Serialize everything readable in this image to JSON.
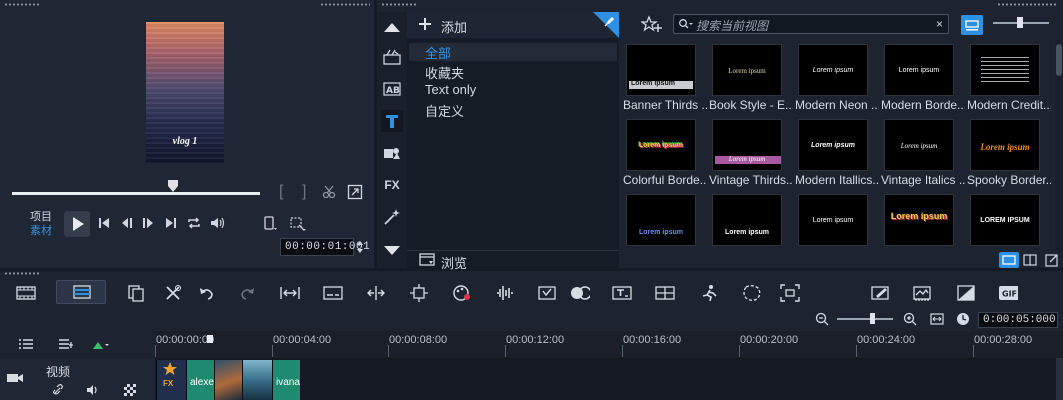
{
  "player": {
    "preview_caption": "vlog 1",
    "mode_project": "项目",
    "mode_clip": "素材",
    "timecode": "00:00:01:001",
    "progress_fraction": 0.65
  },
  "library": {
    "add_label": "添加",
    "tree": [
      "全部",
      "收藏夹",
      "Text only",
      "自定义"
    ],
    "browse_label": "浏览",
    "search_placeholder": "搜索当前视图",
    "thumbnails": [
      {
        "caption": "Banner Thirds ...",
        "sample": "Lorem ipsum"
      },
      {
        "caption": "Book Style - E...",
        "sample": "Lorem ipsum"
      },
      {
        "caption": "Modern Neon ...",
        "sample": "Lorem ipsum"
      },
      {
        "caption": "Modern Borde...",
        "sample": "Lorem ipsum"
      },
      {
        "caption": "Modern Credit...",
        "sample": ""
      },
      {
        "caption": "Colorful Borde...",
        "sample": "Lorem ipsum"
      },
      {
        "caption": "Vintage Thirds...",
        "sample": "Lorem ipsum"
      },
      {
        "caption": "Modern Itallics...",
        "sample": "Lorem ipsum"
      },
      {
        "caption": "Vintage Italics ...",
        "sample": "Lorem ipsum"
      },
      {
        "caption": "Spooky Border...",
        "sample": "Lorem ipsum"
      },
      {
        "caption": "",
        "sample": "Lorem ipsum"
      },
      {
        "caption": "",
        "sample": "Lorem ipsum"
      },
      {
        "caption": "",
        "sample": "Lorem ipsum"
      },
      {
        "caption": "",
        "sample": "Lorem ipsum"
      },
      {
        "caption": "",
        "sample": "LOREM IPSUM"
      }
    ]
  },
  "toolbar": {
    "duration": "0:00:05:000"
  },
  "timeline": {
    "ruler": [
      "00:00:00:00",
      "00:00:04:00",
      "00:00:08:00",
      "00:00:12:00",
      "00:00:16:00",
      "00:00:20:00",
      "00:00:24:00",
      "00:00:28:00"
    ],
    "track_name": "视频",
    "clips": [
      {
        "label": "FX"
      },
      {
        "label": "alexe"
      },
      {
        "label": ""
      },
      {
        "label": ""
      },
      {
        "label": "ivana"
      }
    ]
  },
  "colors": {
    "accent": "#2f8fe0",
    "panel": "#202734",
    "clip_green": "#1f8a6e"
  }
}
